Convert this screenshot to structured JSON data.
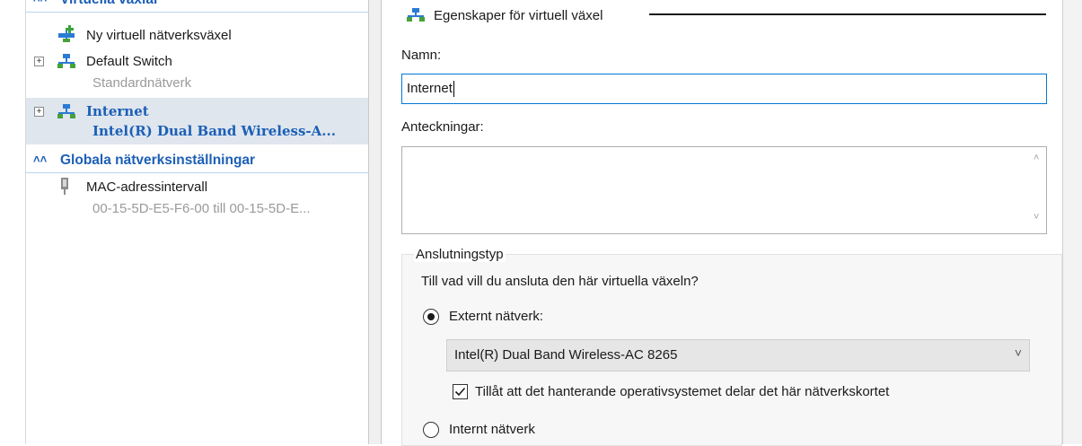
{
  "tree": {
    "section1_label": "Virtuella växlar",
    "new_switch": "Ny virtuell nätverksväxel",
    "default_switch": {
      "name": "Default Switch",
      "sub": "Standardnätverk"
    },
    "internet": {
      "name": "Internet",
      "sub": "Intel(R) Dual Band Wireless-A..."
    },
    "section2_label": "Globala nätverksinställningar",
    "mac": {
      "name": "MAC-adressintervall",
      "sub": "00-15-5D-E5-F6-00 till 00-15-5D-E..."
    }
  },
  "props": {
    "title": "Egenskaper för virtuell växel",
    "name_label": "Namn:",
    "name_value": "Internet",
    "notes_label": "Anteckningar:",
    "notes_value": "",
    "conn_group": "Anslutningstyp",
    "conn_question": "Till vad vill du ansluta den här virtuella växeln?",
    "external_label": "Externt nätverk:",
    "external_selected": true,
    "adapter": "Intel(R) Dual Band Wireless-AC 8265",
    "allow_os_label": "Tillåt att det hanterande operativsystemet delar det här nätverkskortet",
    "allow_os_checked": true,
    "internal_label": "Internt nätverk",
    "internal_selected": false
  },
  "colors": {
    "accent_blue": "#1c5fb6",
    "selection": "#dfe6ee",
    "focus_border": "#0078d7"
  },
  "icons": [
    "network-switch-icon",
    "new-switch-icon",
    "mac-address-icon",
    "chevron-up-icon",
    "scroll-up-icon",
    "scroll-down-icon",
    "dropdown-chevron-icon"
  ]
}
